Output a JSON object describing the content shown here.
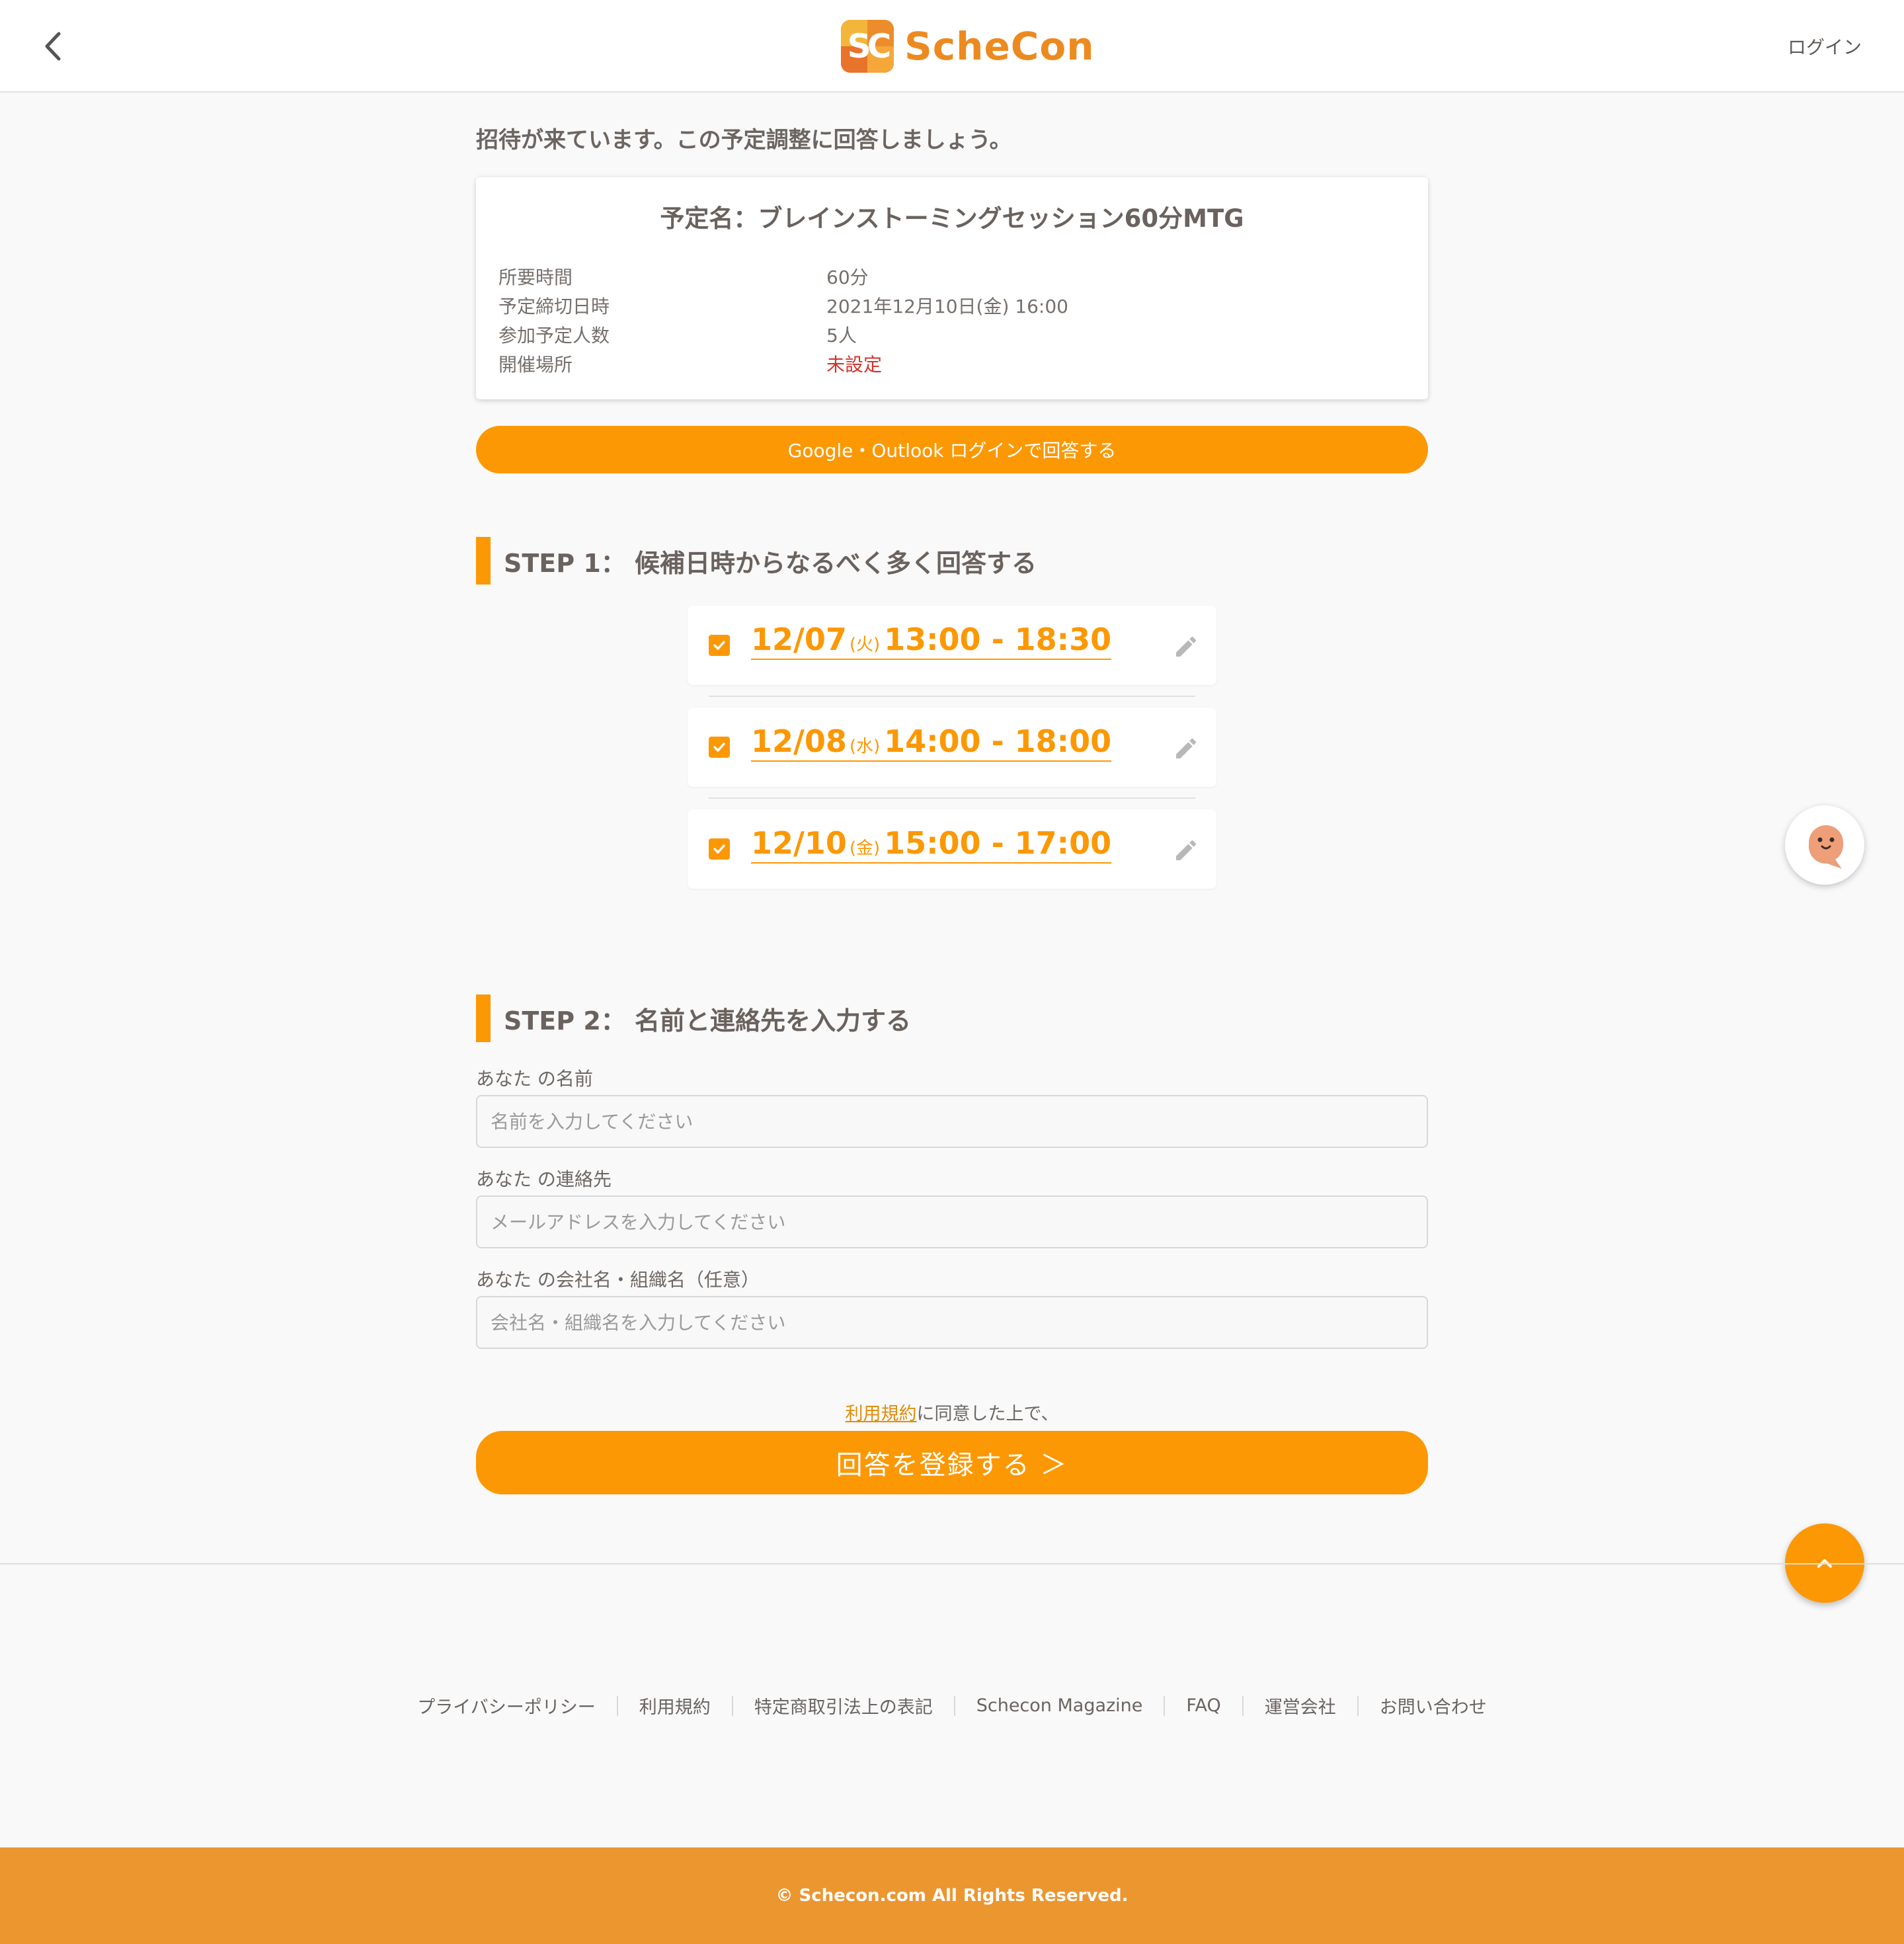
{
  "header": {
    "logo_mark_text": "SC",
    "logo_text": "ScheCon",
    "login_label": "ログイン"
  },
  "intro_text": "招待が来ています。この予定調整に回答しましょう。",
  "event": {
    "title": "予定名：ブレインストーミングセッション60分MTG",
    "details": [
      {
        "label": "所要時間",
        "value": "60分"
      },
      {
        "label": "予定締切日時",
        "value": "2021年12月10日(金) 16:00"
      },
      {
        "label": "参加予定人数",
        "value": "5人"
      },
      {
        "label": "開催場所",
        "value": "未設定"
      }
    ]
  },
  "oauth_button_label": "Google・Outlook ログインで回答する",
  "step1": {
    "title": "STEP 1： 候補日時からなるべく多く回答する",
    "slots": [
      {
        "date": "12/07",
        "dow": "(火)",
        "time": "13:00 - 18:30",
        "checked": true
      },
      {
        "date": "12/08",
        "dow": "(水)",
        "time": "14:00 - 18:00",
        "checked": true
      },
      {
        "date": "12/10",
        "dow": "(金)",
        "time": "15:00 - 17:00",
        "checked": true
      }
    ]
  },
  "step2": {
    "title": "STEP 2： 名前と連絡先を入力する",
    "fields": [
      {
        "label": "あなた の名前",
        "placeholder": "名前を入力してください"
      },
      {
        "label": "あなた の連絡先",
        "placeholder": "メールアドレスを入力してください"
      },
      {
        "label": "あなた の会社名・組織名（任意）",
        "placeholder": "会社名・組織名を入力してください"
      }
    ]
  },
  "terms": {
    "link_text": "利用規約",
    "suffix": "に同意した上で、"
  },
  "submit_label": "回答を登録する ＞",
  "footer": {
    "links": [
      "プライバシーポリシー",
      "利用規約",
      "特定商取引法上の表記",
      "Schecon Magazine",
      "FAQ",
      "運営会社",
      "お問い合わせ"
    ],
    "copyright": "© Schecon.com All Rights Reserved."
  },
  "colors": {
    "accent": "#fb9804",
    "footer_bar": "#ec9630",
    "warning_red": "#d0342c"
  },
  "icons": {
    "back": "chevron-left-icon",
    "checkbox": "checkbox-checked-icon",
    "edit": "pencil-icon",
    "chat": "chat-mascot-icon",
    "scroll_top": "chevron-up-icon"
  }
}
